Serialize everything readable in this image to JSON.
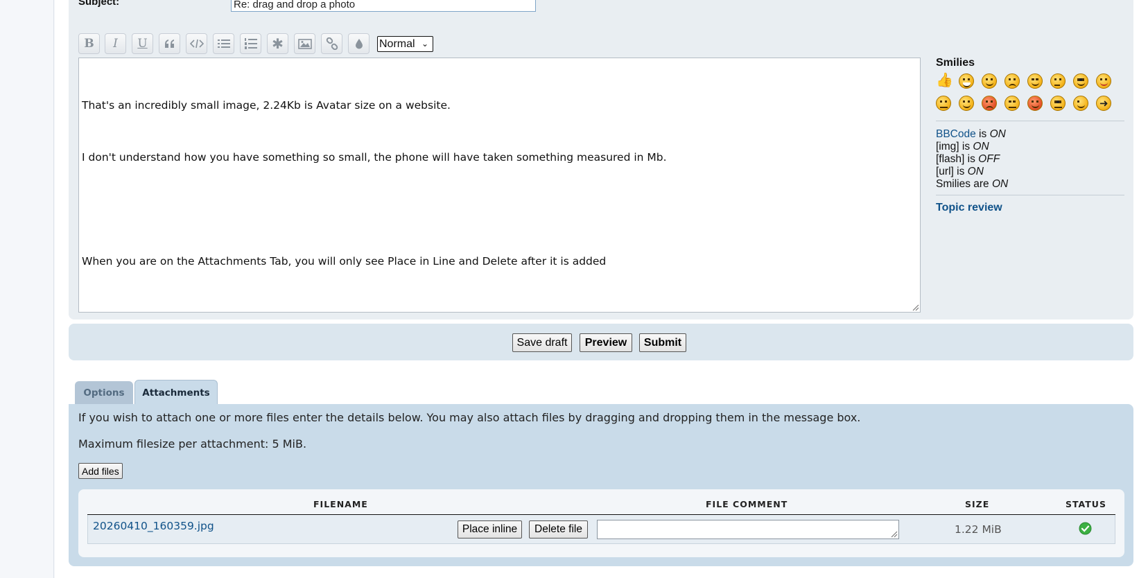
{
  "compose": {
    "subject_label": "Subject:",
    "subject_value": "Re: drag and drop a photo",
    "toolbar": {
      "buttons": [
        "bold-icon",
        "italic-icon",
        "underline-icon",
        "quote-icon",
        "code-icon",
        "list-icon",
        "ordered-list-icon",
        "list-item-icon",
        "image-icon",
        "link-icon",
        "color-icon"
      ],
      "bold_label": "B",
      "italic_label": "I",
      "underline_label": "U",
      "list_item_label": "✱",
      "font_size_selected": "Normal"
    },
    "message_lines": [
      "That's an incredibly small image, 2.24Kb is Avatar size on a website.",
      "I don't understand how you have something so small, the phone will have taken something measured in Mb.",
      "",
      "When you are on the Attachments Tab, you will only see Place in Line and Delete after it is added"
    ]
  },
  "sidebar": {
    "smilies_title": "Smilies",
    "smilies": [
      "thumbs-up",
      "laughing",
      "grinning",
      "sad",
      "geek",
      "confused",
      "cool",
      "razz",
      "mad",
      "smile",
      "evil",
      "nerd",
      "twisted-evil",
      "rolling-eyes",
      "wink",
      "arrow"
    ],
    "bbcode_link": "BBCode",
    "bbcode_is": "is",
    "bbcode_state": "ON",
    "img_label": "[img] is",
    "img_state": "ON",
    "flash_label": "[flash] is",
    "flash_state": "OFF",
    "url_label": "[url] is",
    "url_state": "ON",
    "smilies_label": "Smilies are",
    "smilies_state": "ON",
    "topic_review": "Topic review"
  },
  "actions": {
    "save_draft": "Save draft",
    "preview": "Preview",
    "submit": "Submit"
  },
  "tabs": {
    "options": "Options",
    "attachments": "Attachments"
  },
  "attachments": {
    "intro": "If you wish to attach one or more files enter the details below. You may also attach files by dragging and dropping them in the message box.",
    "max_size": "Maximum filesize per attachment: 5 MiB.",
    "add_files": "Add files",
    "columns": [
      "FILENAME",
      "FILE COMMENT",
      "SIZE",
      "STATUS"
    ],
    "files": [
      {
        "filename": "20260410_160359.jpg",
        "place_inline": "Place inline",
        "delete_file": "Delete file",
        "comment": "",
        "size": "1.22 MiB",
        "status": "success-check-icon"
      }
    ]
  },
  "colors": {
    "link": "#105289",
    "panel": "#e9eef2",
    "attach_panel": "#c9dbe9",
    "status_ok": "#3cb043"
  }
}
